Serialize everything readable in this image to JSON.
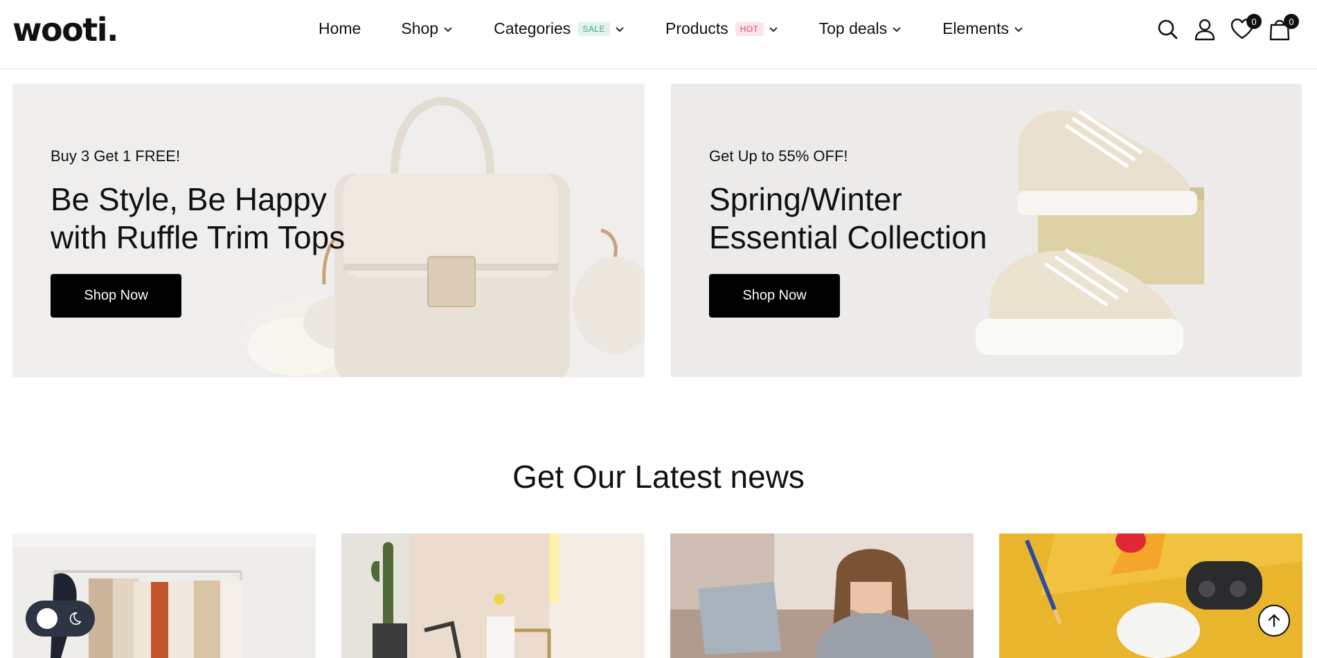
{
  "brand": {
    "logo": "wooti."
  },
  "nav": {
    "items": [
      {
        "label": "Home",
        "has_dropdown": false
      },
      {
        "label": "Shop",
        "has_dropdown": true
      },
      {
        "label": "Categories",
        "badge": "SALE",
        "has_dropdown": true
      },
      {
        "label": "Products",
        "badge": "HOT",
        "has_dropdown": true
      },
      {
        "label": "Top deals",
        "has_dropdown": true
      },
      {
        "label": "Elements",
        "has_dropdown": true
      }
    ]
  },
  "header_icons": {
    "search": "search-icon",
    "account": "user-icon",
    "wishlist": {
      "icon": "heart-icon",
      "count": "0"
    },
    "cart": {
      "icon": "shopping-bag-icon",
      "count": "0"
    }
  },
  "banners": [
    {
      "eyebrow": "Buy 3 Get 1 FREE!",
      "headline_line1": "Be Style, Be Happy",
      "headline_line2": "with Ruffle Trim Tops",
      "button": "Shop Now",
      "image": "handbag-image"
    },
    {
      "eyebrow": "Get Up to 55% OFF!",
      "headline_line1": "Spring/Winter",
      "headline_line2": "Essential Collection",
      "button": "Shop Now",
      "image": "sneakers-image"
    }
  ],
  "news": {
    "title": "Get Our Latest news",
    "cards": [
      {
        "image": "clothing-rack-image"
      },
      {
        "image": "interior-cactus-image"
      },
      {
        "image": "woman-smiling-image"
      },
      {
        "image": "earbuds-image"
      }
    ]
  },
  "floating": {
    "theme_toggle": "theme-toggle",
    "scroll_top": "arrow-up-icon"
  },
  "colors": {
    "sale_badge_bg": "#e2f3ee",
    "sale_badge_text": "#3aa58a",
    "hot_badge_bg": "#fde4ea",
    "hot_badge_text": "#e2456e",
    "button": "#000000",
    "banner_bg": "#efeeec"
  }
}
